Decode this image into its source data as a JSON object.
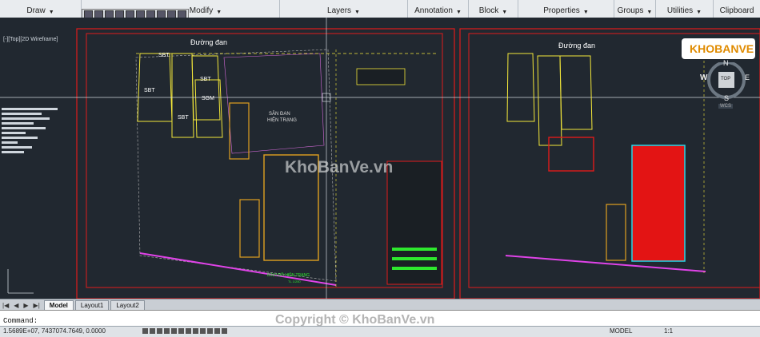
{
  "ribbon": {
    "panels": [
      {
        "label": "Draw"
      },
      {
        "label": "Modify"
      },
      {
        "label": "Layers"
      },
      {
        "label": "Annotation"
      },
      {
        "label": "Block"
      },
      {
        "label": "Properties"
      },
      {
        "label": "Groups"
      },
      {
        "label": "Utilities"
      },
      {
        "label": "Clipboard"
      }
    ]
  },
  "viewport": {
    "label": "[-][Top][2D Wireframe]",
    "close": "×"
  },
  "drawing": {
    "road_label_left": "Đường đan",
    "road_label_right": "Đường đan",
    "sbt": "SBT",
    "sgm": "SGM",
    "san_dan": "SÂN ĐAN",
    "hien_trang": "HIỆN TRẠNG",
    "title_block": "BÌNH ĐỒ HIỆN TRẠNG",
    "scale": "TL 1/200"
  },
  "compass": {
    "top": "TOP",
    "n": "N",
    "w": "W",
    "e": "E",
    "s": "S",
    "wcs": "WCS"
  },
  "logo": {
    "text": "KHOBANVE"
  },
  "watermarks": {
    "center": "KhoBanVe.vn",
    "bottom": "Copyright © KhoBanVe.vn"
  },
  "layout_tabs": [
    "Model",
    "Layout1",
    "Layout2"
  ],
  "command": {
    "label": "Command:"
  },
  "status": {
    "coords": "1.5689E+07, 7437074.7649, 0.0000",
    "model": "MODEL",
    "scale": "1:1"
  },
  "colors": {
    "frame_red": "#e01b1b",
    "building_orange": "#e0a020",
    "building_yellow": "#f3e73a",
    "fill_red": "#e31414",
    "cyan": "#24d6e8",
    "magenta": "#e043e8",
    "green": "#2ee82e"
  }
}
